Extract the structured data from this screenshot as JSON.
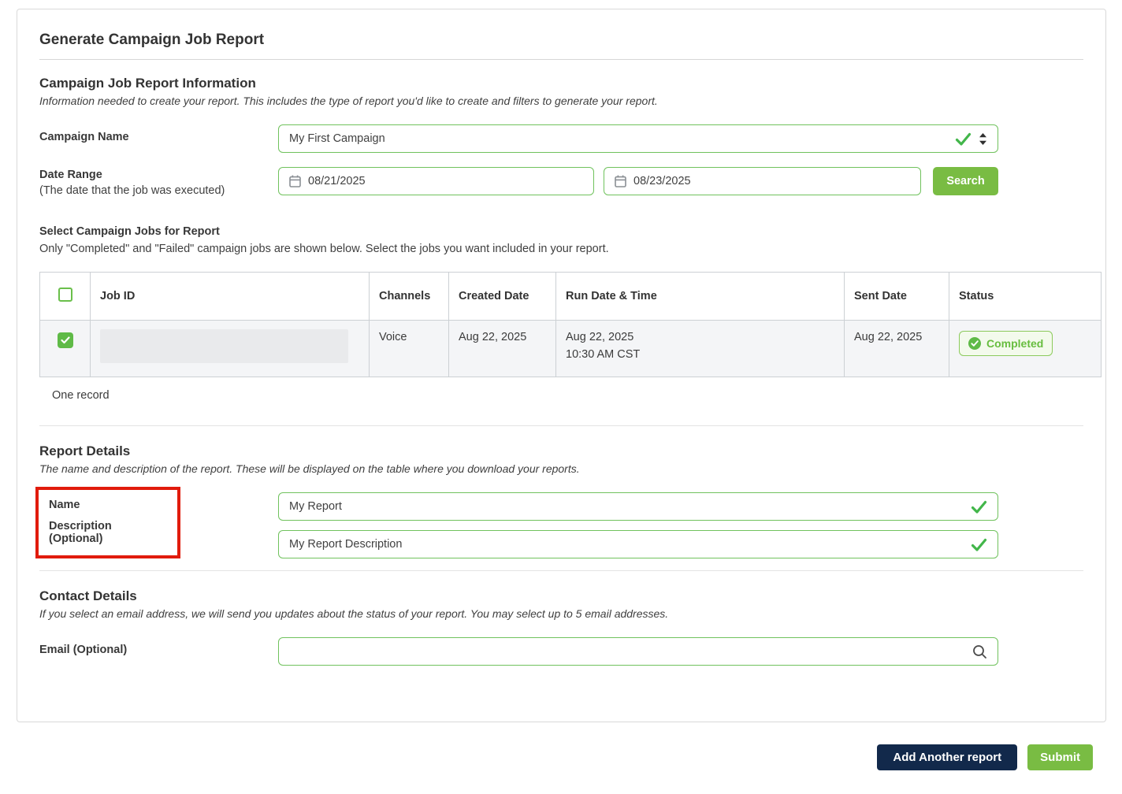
{
  "page": {
    "title": "Generate Campaign Job Report"
  },
  "info_section": {
    "heading": "Campaign Job Report Information",
    "description": "Information needed to create your report. This includes the type of report you'd like to create and filters to generate your report.",
    "campaign_name": {
      "label": "Campaign Name",
      "value": "My First Campaign"
    },
    "date_range": {
      "label": "Date Range",
      "sublabel": "(The date that the job was executed)",
      "start_value": "08/21/2025",
      "end_value": "08/23/2025",
      "search_label": "Search"
    }
  },
  "jobs_section": {
    "heading": "Select Campaign Jobs for Report",
    "description": "Only \"Completed\" and \"Failed\" campaign jobs are shown below. Select the jobs you want included in your report.",
    "table": {
      "columns": [
        "Job ID",
        "Channels",
        "Created Date",
        "Run Date & Time",
        "Sent Date",
        "Status"
      ],
      "rows": [
        {
          "selected": true,
          "job_id_redacted": "",
          "channels": "Voice",
          "created_date": "Aug 22, 2025",
          "run_date": "Aug 22, 2025",
          "run_time": "10:30 AM CST",
          "sent_date": "Aug 22, 2025",
          "status": "Completed"
        }
      ]
    },
    "record_count": "One record"
  },
  "report_section": {
    "heading": "Report Details",
    "description": "The name and description of the report. These will be displayed on the table where you download your reports.",
    "name": {
      "label": "Name",
      "value": "My Report"
    },
    "desc": {
      "label": "Description (Optional)",
      "value": "My Report Description"
    }
  },
  "contact_section": {
    "heading": "Contact Details",
    "description": "If you select an email address, we will send you updates about the status of your report. You may select up to 5 email addresses.",
    "email": {
      "label": "Email (Optional)",
      "value": "",
      "placeholder": ""
    }
  },
  "footer": {
    "add_label": "Add Another report",
    "submit_label": "Submit"
  },
  "colors": {
    "accent_green": "#79bc43",
    "input_border_green": "#70c25d",
    "check_green": "#42b64a",
    "badge_text_green": "#67bd3f",
    "navy": "#12294b",
    "highlight_red": "#e11b0c"
  }
}
